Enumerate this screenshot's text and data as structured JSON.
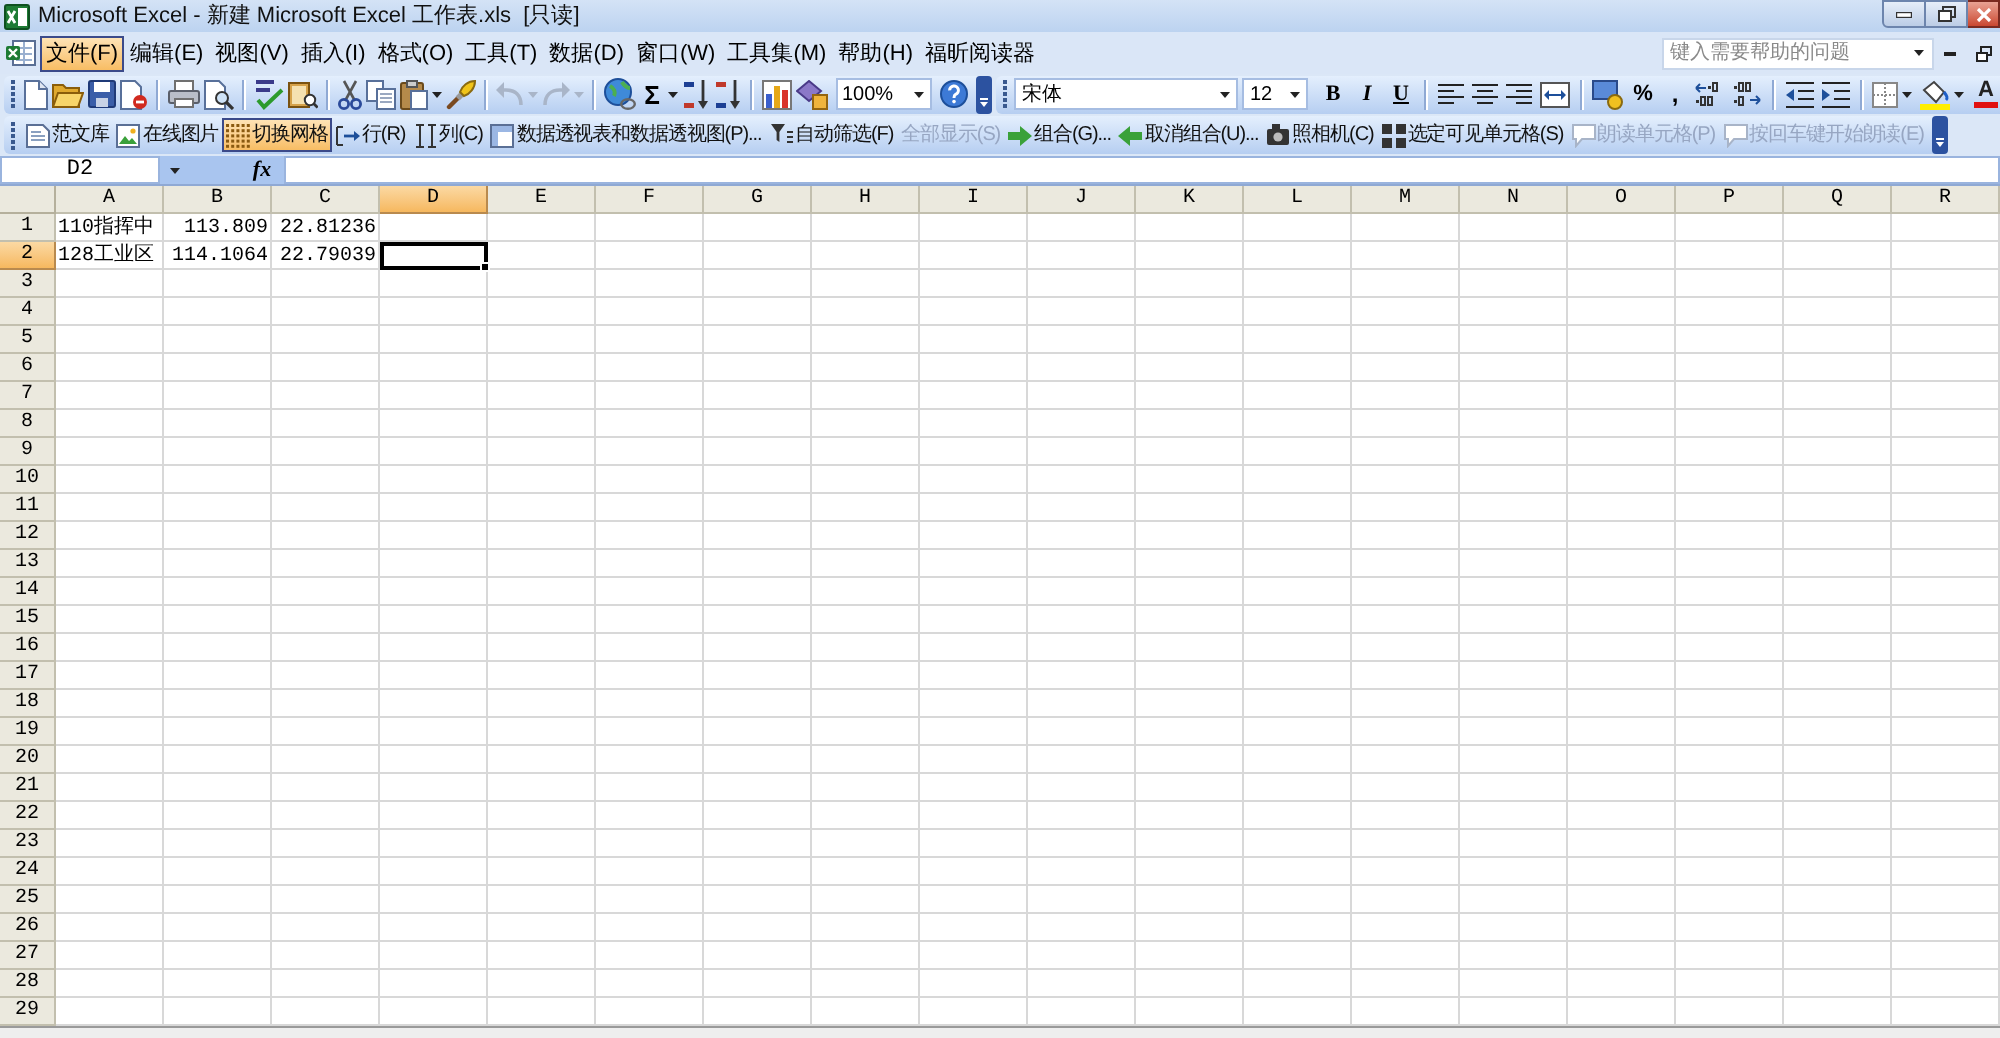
{
  "window": {
    "title": "Microsoft Excel - 新建 Microsoft Excel 工作表.xls  [只读]"
  },
  "menu_bar": {
    "items": [
      {
        "label": "文件(F)",
        "selected": true
      },
      {
        "label": "编辑(E)",
        "selected": false
      },
      {
        "label": "视图(V)",
        "selected": false
      },
      {
        "label": "插入(I)",
        "selected": false
      },
      {
        "label": "格式(O)",
        "selected": false
      },
      {
        "label": "工具(T)",
        "selected": false
      },
      {
        "label": "数据(D)",
        "selected": false
      },
      {
        "label": "窗口(W)",
        "selected": false
      },
      {
        "label": "工具集(M)",
        "selected": false
      },
      {
        "label": "帮助(H)",
        "selected": false
      },
      {
        "label": "福昕阅读器",
        "selected": false
      }
    ],
    "help_box": {
      "placeholder": "键入需要帮助的问题"
    }
  },
  "standard_toolbar": {
    "undo": {
      "disabled": true
    },
    "redo": {
      "disabled": true
    },
    "autosum": "Σ",
    "zoom": "100%"
  },
  "formatting_toolbar": {
    "font": "宋体",
    "font_size": "12",
    "bold": "B",
    "italic": "I",
    "underline": "U",
    "percent": "%",
    "comma": ",",
    "font_color": "A"
  },
  "custom_toolbar": {
    "items": [
      {
        "label": "范文库",
        "on": false,
        "disabled": false
      },
      {
        "label": "在线图片",
        "on": false,
        "disabled": false
      },
      {
        "label": "切换网格",
        "on": true,
        "disabled": false
      },
      {
        "label": "行(R)",
        "on": false,
        "disabled": false
      },
      {
        "label": "列(C)",
        "on": false,
        "disabled": false
      },
      {
        "label": "数据透视表和数据透视图(P)...",
        "on": false,
        "disabled": false
      },
      {
        "label": "自动筛选(F)",
        "on": false,
        "disabled": false
      },
      {
        "label": "全部显示(S)",
        "on": false,
        "disabled": true
      },
      {
        "label": "组合(G)...",
        "on": false,
        "disabled": false
      },
      {
        "label": "取消组合(U)...",
        "on": false,
        "disabled": false
      },
      {
        "label": "照相机(C)",
        "on": false,
        "disabled": false
      },
      {
        "label": "选定可见单元格(S)",
        "on": false,
        "disabled": false
      },
      {
        "label": "朗读单元格(P)",
        "on": false,
        "disabled": true
      },
      {
        "label": "按回车键开始朗读(E)",
        "on": false,
        "disabled": true
      }
    ]
  },
  "formula_bar": {
    "name_box": "D2",
    "function_label": "fx"
  },
  "sheet": {
    "columns": [
      {
        "label": "A",
        "selected": false
      },
      {
        "label": "B",
        "selected": false
      },
      {
        "label": "C",
        "selected": false
      },
      {
        "label": "D",
        "selected": true
      },
      {
        "label": "E",
        "selected": false
      },
      {
        "label": "F",
        "selected": false
      },
      {
        "label": "G",
        "selected": false
      },
      {
        "label": "H",
        "selected": false
      },
      {
        "label": "I",
        "selected": false
      },
      {
        "label": "J",
        "selected": false
      },
      {
        "label": "K",
        "selected": false
      },
      {
        "label": "L",
        "selected": false
      },
      {
        "label": "M",
        "selected": false
      },
      {
        "label": "N",
        "selected": false
      },
      {
        "label": "O",
        "selected": false
      },
      {
        "label": "P",
        "selected": false
      },
      {
        "label": "Q",
        "selected": false
      },
      {
        "label": "R",
        "selected": false
      }
    ],
    "rows": [
      {
        "label": "1",
        "selected": false,
        "cells": [
          {
            "kind": "text",
            "value": "110指挥中",
            "selected": false
          },
          {
            "kind": "number",
            "value": "113.809",
            "selected": false
          },
          {
            "kind": "number",
            "value": "22.81236",
            "selected": false
          }
        ]
      },
      {
        "label": "2",
        "selected": true,
        "cells": [
          {
            "kind": "text",
            "value": "128工业区",
            "selected": false
          },
          {
            "kind": "number",
            "value": "114.1064",
            "selected": false
          },
          {
            "kind": "number",
            "value": "22.79039",
            "selected": false
          },
          {
            "kind": "empty",
            "selected": true
          }
        ]
      },
      {
        "label": "3",
        "selected": false
      },
      {
        "label": "4",
        "selected": false
      },
      {
        "label": "5",
        "selected": false
      },
      {
        "label": "6",
        "selected": false
      },
      {
        "label": "7",
        "selected": false
      },
      {
        "label": "8",
        "selected": false
      },
      {
        "label": "9",
        "selected": false
      },
      {
        "label": "10",
        "selected": false
      },
      {
        "label": "11",
        "selected": false
      },
      {
        "label": "12",
        "selected": false
      },
      {
        "label": "13",
        "selected": false
      },
      {
        "label": "14",
        "selected": false
      },
      {
        "label": "15",
        "selected": false
      },
      {
        "label": "16",
        "selected": false
      },
      {
        "label": "17",
        "selected": false
      },
      {
        "label": "18",
        "selected": false
      },
      {
        "label": "19",
        "selected": false
      },
      {
        "label": "20",
        "selected": false
      },
      {
        "label": "21",
        "selected": false
      },
      {
        "label": "22",
        "selected": false
      },
      {
        "label": "23",
        "selected": false
      },
      {
        "label": "24",
        "selected": false
      },
      {
        "label": "25",
        "selected": false
      },
      {
        "label": "26",
        "selected": false
      },
      {
        "label": "27",
        "selected": false
      },
      {
        "label": "28",
        "selected": false
      },
      {
        "label": "29",
        "selected": false
      }
    ]
  }
}
